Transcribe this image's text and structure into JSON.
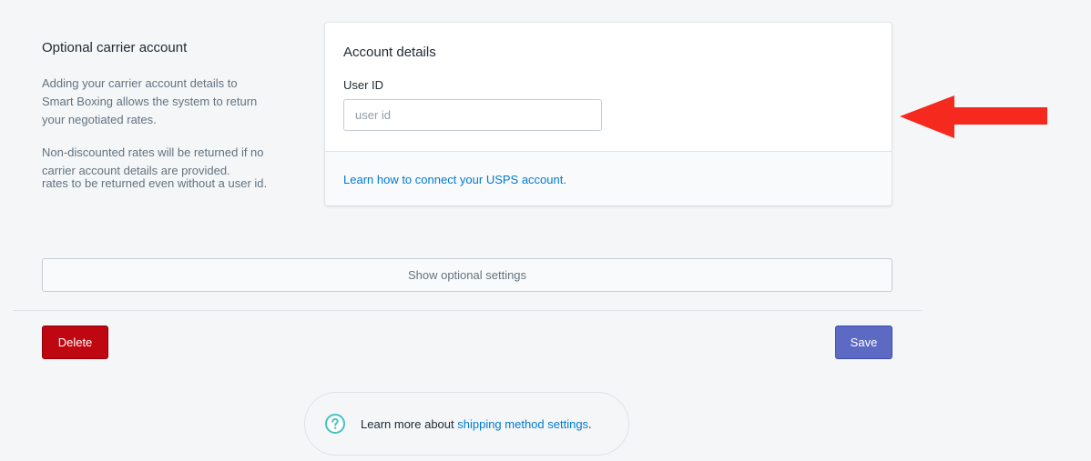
{
  "section": {
    "title": "Optional carrier account",
    "desc_p1": "Adding your carrier account details to Smart Boxing allows the system to return your negotiated rates.",
    "desc_p2": "Non-discounted rates will be returned if no carrier account details are provided.",
    "desc_p3": "rates to be returned even without a user id."
  },
  "card": {
    "title": "Account details",
    "field_label": "User ID",
    "field_placeholder": "user id",
    "field_value": "",
    "footer_link": "Learn how to connect your USPS account."
  },
  "optional_settings_label": "Show optional settings",
  "actions": {
    "delete_label": "Delete",
    "save_label": "Save"
  },
  "help": {
    "prefix": "Learn more about ",
    "link": "shipping method settings",
    "suffix": "."
  },
  "colors": {
    "arrow": "#f5291e",
    "delete": "#bf0711",
    "save": "#5c6ac4",
    "link": "#007ace",
    "help_icon": "#47c1bf"
  },
  "icons": {
    "help": "question-circle-icon",
    "annotation": "red-arrow-left-icon"
  }
}
